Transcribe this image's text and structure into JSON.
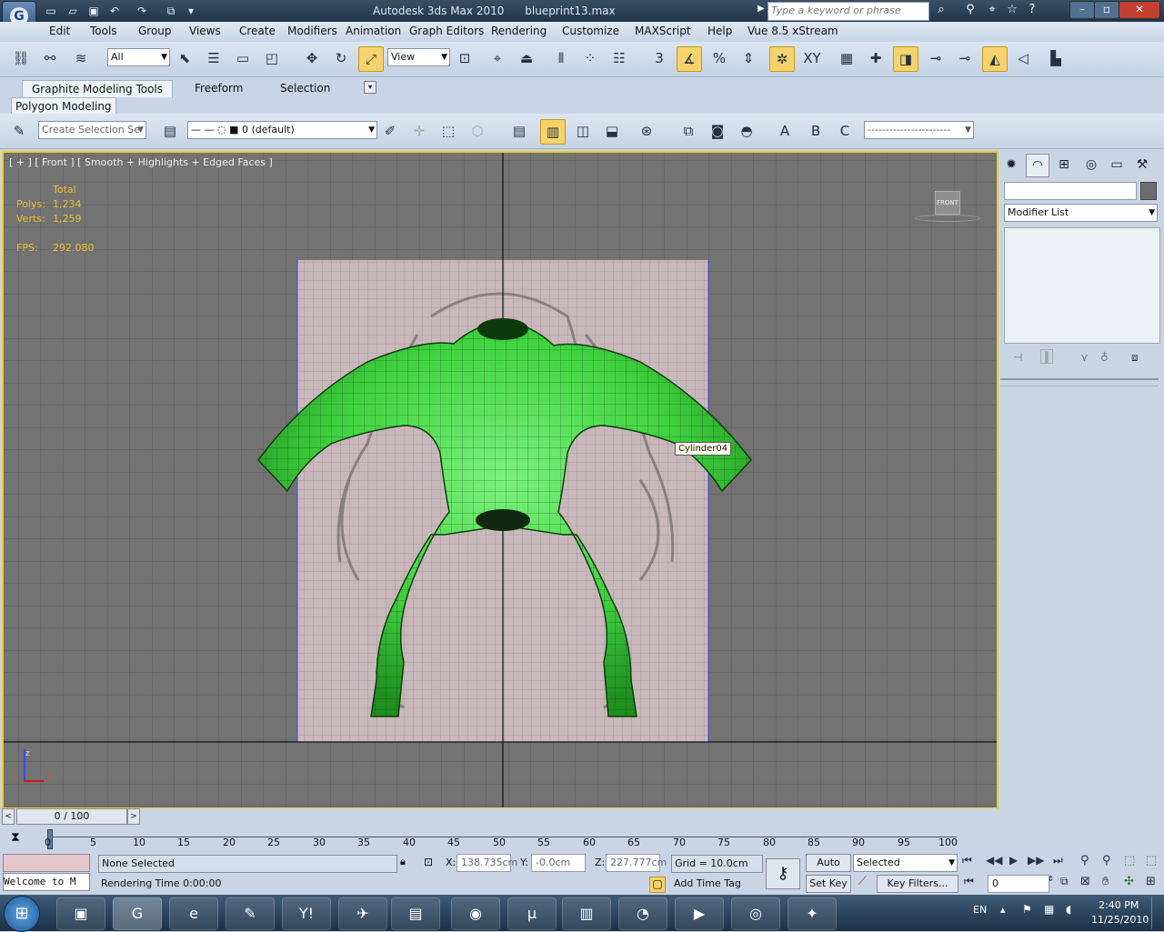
{
  "window": {
    "title": "Autodesk 3ds Max  2010",
    "file": "blueprint13.max",
    "search_placeholder": "Type a keyword or phrase"
  },
  "menu": [
    "Edit",
    "Tools",
    "Group",
    "Views",
    "Create",
    "Modifiers",
    "Animation",
    "Graph Editors",
    "Rendering",
    "Customize",
    "MAXScript",
    "Help",
    "Vue 8.5 xStream"
  ],
  "toolbar": {
    "selection_filter": "All",
    "ref_coord": "View",
    "snap_number": "3"
  },
  "ribbon": {
    "tabs": [
      "Graphite Modeling Tools",
      "Freeform",
      "Selection"
    ],
    "subtab": "Polygon Modeling",
    "named_selection": "Create Selection Se",
    "layer": "0 (default)"
  },
  "viewport": {
    "label": "[ + ] [ Front ] [ Smooth + Highlights + Edged Faces ]",
    "stats": {
      "header": "Total",
      "polys_label": "Polys:",
      "polys": "1,234",
      "verts_label": "Verts:",
      "verts": "1,259",
      "fps_label": "FPS:",
      "fps": "292.080"
    },
    "tooltip": "Cylinder04",
    "viewcube_label": "FRONT",
    "axis_z": "z",
    "axis_x": "x"
  },
  "command_panel": {
    "modifier_list": "Modifier List"
  },
  "timeline": {
    "frame_display": "0 / 100",
    "ticks": [
      "0",
      "5",
      "10",
      "15",
      "20",
      "25",
      "30",
      "35",
      "40",
      "45",
      "50",
      "55",
      "60",
      "65",
      "70",
      "75",
      "80",
      "85",
      "90",
      "95",
      "100"
    ]
  },
  "status": {
    "selection": "None Selected",
    "rendering_time": "Rendering Time  0:00:00",
    "maxscript_listener": "Welcome to M",
    "x_label": "X:",
    "x": "138.735cm",
    "y_label": "Y:",
    "y": "-0.0cm",
    "z_label": "Z:",
    "z": "227.777cm",
    "grid": "Grid = 10.0cm",
    "add_time_tag": "Add Time Tag",
    "auto_key": "Auto Key",
    "set_key": "Set Key",
    "key_mode": "Selected",
    "key_filters": "Key Filters...",
    "current_frame": "0"
  },
  "taskbar": {
    "language": "EN",
    "time": "2:40 PM",
    "date": "11/25/2010"
  }
}
